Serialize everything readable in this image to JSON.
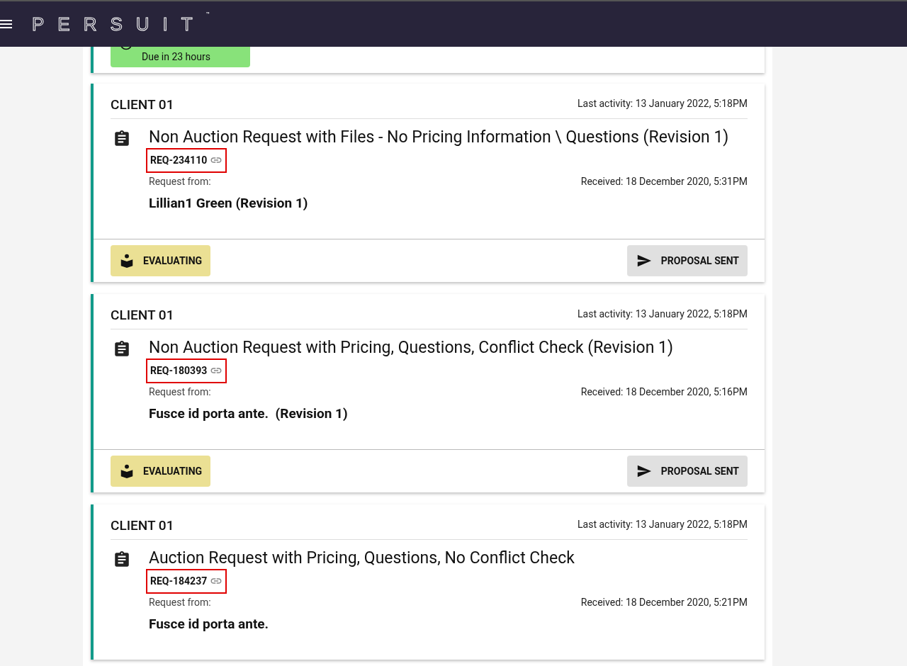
{
  "header": {
    "logo": "PERSUIT",
    "trademark": "™"
  },
  "top_card": {
    "due": "Due in 23 hours"
  },
  "requests": [
    {
      "client": "CLIENT 01",
      "last_activity": "Last activity: 13 January 2022, 5:18PM",
      "title": "Non Auction Request with Files - No Pricing Information \\ Questions (Revision 1)",
      "ref": "REQ-234110",
      "highlighted": true,
      "from_label": "Request from:",
      "received": "Received: 18 December 2020, 5:31PM",
      "from": "Lillian1 Green (Revision 1)",
      "status": "EVALUATING",
      "action": "PROPOSAL SENT"
    },
    {
      "client": "CLIENT 01",
      "last_activity": "Last activity: 13 January 2022, 5:18PM",
      "title": "Non Auction Request with Pricing, Questions, Conflict Check (Revision 1)",
      "ref": "REQ-180393",
      "highlighted": true,
      "from_label": "Request from:",
      "received": "Received: 18 December 2020, 5:16PM",
      "from": "Fusce id porta ante.  (Revision 1)",
      "status": "EVALUATING",
      "action": "PROPOSAL SENT"
    },
    {
      "client": "CLIENT 01",
      "last_activity": "Last activity: 13 January 2022, 5:18PM",
      "title": "Auction Request with Pricing, Questions, No Conflict Check",
      "ref": "REQ-184237",
      "highlighted": true,
      "from_label": "Request from:",
      "received": "Received: 18 December 2020, 5:21PM",
      "from": "Fusce id porta ante."
    }
  ]
}
